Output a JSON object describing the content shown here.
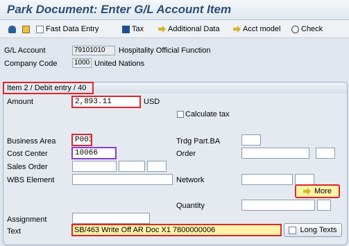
{
  "window": {
    "title": "Park Document: Enter G/L Account Item"
  },
  "toolbar": {
    "fast_data_entry": "Fast Data Entry",
    "tax": "Tax",
    "additional_data": "Additional Data",
    "acct_model": "Acct model",
    "check": "Check"
  },
  "header": {
    "gl_account_label": "G/L Account",
    "gl_account_value": "79101010",
    "gl_account_text": "Hospitality Official Function",
    "company_code_label": "Company Code",
    "company_code_value": "1000",
    "company_code_text": "United Nations"
  },
  "item": {
    "frame_title": "Item 2 / Debit entry / 40",
    "amount_label": "Amount",
    "amount_value": "2,893.11",
    "currency": "USD",
    "calculate_tax_label": "Calculate tax",
    "calculate_tax_checked": false,
    "business_area_label": "Business Area",
    "business_area_value": "P003",
    "trdg_part_label": "Trdg Part.BA",
    "trdg_part_value": "",
    "cost_center_label": "Cost Center",
    "cost_center_value": "10066",
    "order_label": "Order",
    "order_value": "",
    "sales_order_label": "Sales Order",
    "wbs_label": "WBS Element",
    "wbs_value": "",
    "network_label": "Network",
    "network_value": "",
    "more_label": "More",
    "quantity_label": "Quantity",
    "quantity_value": "",
    "assignment_label": "Assignment",
    "assignment_value": "",
    "text_label": "Text",
    "text_value": "SB/463 Write Off AR Doc X1 7800000006",
    "long_texts_label": "Long Texts"
  },
  "colors": {
    "highlight_red": "#e0242b",
    "highlight_purple": "#8a3ad6",
    "more_button_bg": "#fff3a8",
    "text_field_bg": "#fff3a8"
  }
}
